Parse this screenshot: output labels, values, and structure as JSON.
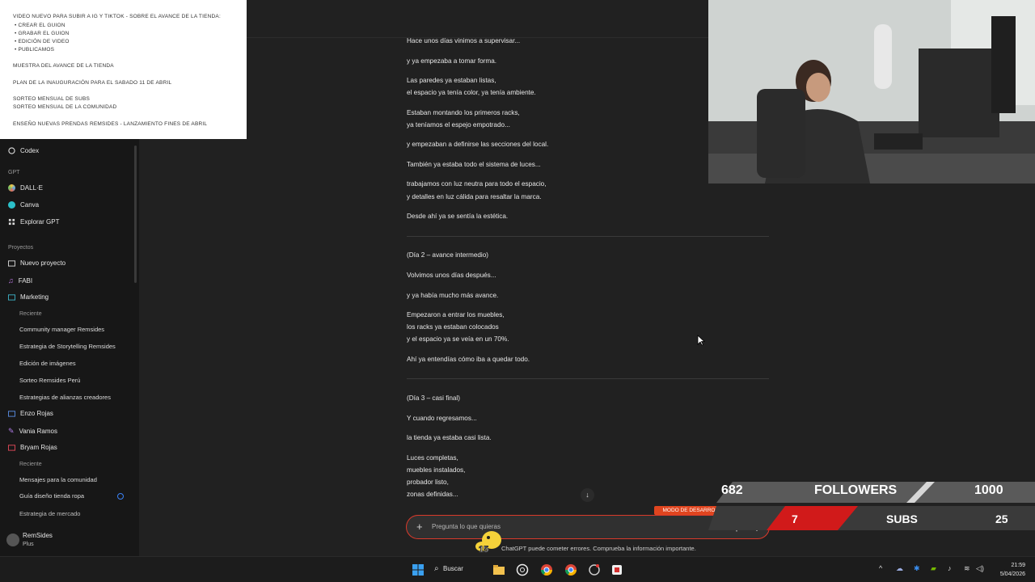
{
  "notes": {
    "title": "VIDEO NUEVO PARA SUBIR A IG Y TIKTOK - SOBRE EL AVANCE DE LA TIENDA:",
    "items": [
      "CREAR EL GUION",
      "GRABAR EL GUION",
      "EDICIÓN DE VIDEO",
      "PUBLICAMOS"
    ],
    "line1": "MUESTRA DEL AVANCE DE LA TIENDA",
    "line2": "PLAN DE LA INAUGURACIÓN PARA EL SABADO 11 DE ABRIL",
    "line3": "SORTEO MENSUAL DE SUBS",
    "line4": "SORTEO MENSUAL DE LA COMUNIDAD",
    "line5": "ENSEÑO NUEVAS PRENDAS REMSIDES - LANZAMIENTO FINES DE ABRIL"
  },
  "sidebar": {
    "codex": "Codex",
    "gpt_header": "GPT",
    "gpts": [
      {
        "label": "DALL·E",
        "color": "#5aa9e6"
      },
      {
        "label": "Canva",
        "color": "#2bc0c9"
      },
      {
        "label": "Explorar GPT",
        "color": "#cfcfcf"
      }
    ],
    "projects_header": "Proyectos",
    "new_project": "Nuevo proyecto",
    "fabi": "FABI",
    "marketing": "Marketing",
    "recent1": "Reciente",
    "marketing_chats": [
      "Community manager Remsides",
      "Estrategia de Storytelling Remsides",
      "Edición de imágenes",
      "Sorteo Remsides Perú",
      "Estrategias de alianzas creadores"
    ],
    "enzo": "Enzo Rojas",
    "vania": "Vania Ramos",
    "bryam": "Bryam Rojas",
    "recent2": "Reciente",
    "bryam_chats": [
      "Mensajes para la comunidad",
      "Guía diseño tienda ropa",
      "Estrategia de mercado"
    ],
    "user_name": "RemSides",
    "user_plan": "Plus"
  },
  "chat": {
    "lines": [
      "Hace unos días vinimos a supervisar...",
      "y ya empezaba a tomar forma.",
      "Las paredes ya estaban listas,",
      "el espacio ya tenía color, ya tenía ambiente.",
      "Estaban montando los primeros racks,",
      "ya teníamos el espejo empotrado...",
      "y empezaban a definirse las secciones del local.",
      "También ya estaba todo el sistema de luces...",
      "trabajamos con luz neutra para todo el espacio,",
      "y detalles en luz cálida para resaltar la marca.",
      "Desde ahí ya se sentía la estética.",
      "(Día 2 – avance intermedio)",
      "Volvimos unos días después...",
      "y ya había mucho más avance.",
      "Empezaron a entrar los muebles,",
      "los racks ya estaban colocados",
      "y el espacio ya se veía en un 70%.",
      "Ahí ya entendías cómo iba a quedar todo.",
      "(Día 3 – casi final)",
      "Y cuando regresamos...",
      "la tienda ya estaba casi lista.",
      "Luces completas,",
      "muebles instalados,",
      "probador listo,",
      "zonas definidas..."
    ]
  },
  "composer": {
    "placeholder": "Pregunta lo que quieras",
    "disclaimer": "ChatGPT puede cometer errores. Comprueba la información importante.",
    "dev_mode": "MODO DE DESARROLLADOR"
  },
  "overlay": {
    "followers_count": "682",
    "followers_label": "FOLLOWERS",
    "followers_goal": "1000",
    "subs_count": "7",
    "subs_label": "SUBS",
    "subs_goal": "25",
    "badge": "15"
  },
  "taskbar": {
    "search": "Buscar",
    "time": "21:59",
    "date": "5/04/2026"
  }
}
